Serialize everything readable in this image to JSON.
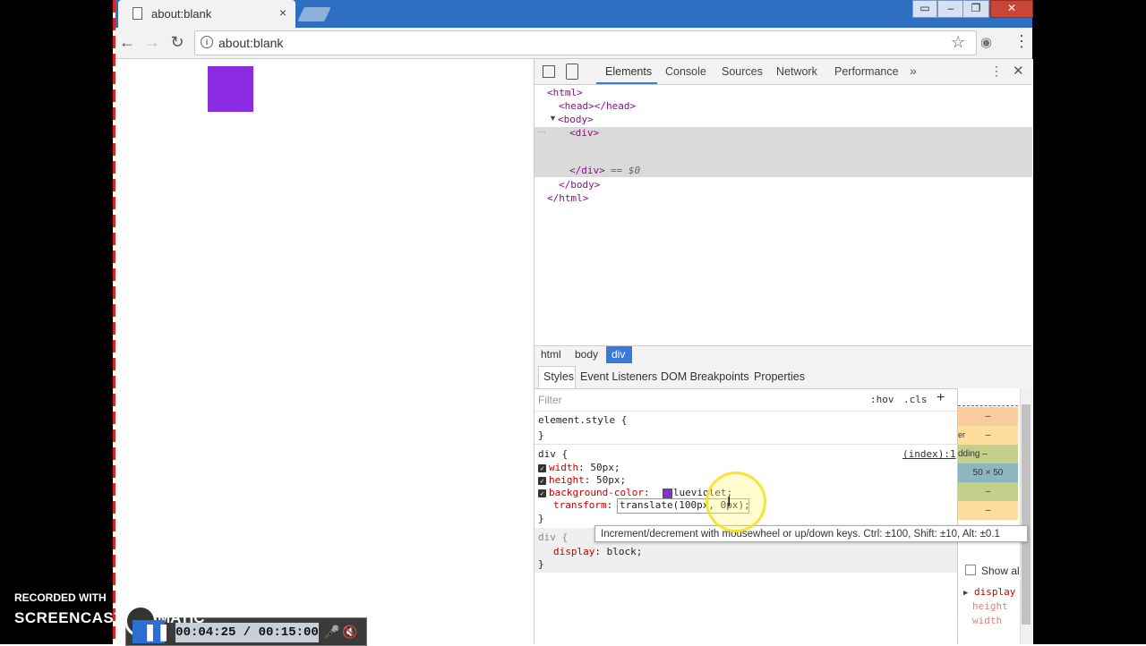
{
  "browser": {
    "tab_title": "about:blank",
    "tab_close": "×",
    "url": "about:blank",
    "win_buttons": {
      "restore": "▭",
      "minimize": "–",
      "maximize": "❐",
      "close": "✕"
    },
    "nav": {
      "back": "←",
      "forward": "→",
      "reload": "↻",
      "star": "☆",
      "camera": "◉",
      "menu": "⋮"
    }
  },
  "page": {
    "box_color": "#8a2be2"
  },
  "devtools": {
    "tabs": [
      "Elements",
      "Console",
      "Sources",
      "Network",
      "Performance"
    ],
    "more_tabs": "»",
    "kebab": "⋮",
    "close": "✕",
    "dom": {
      "html_open": "<html>",
      "head": "<head></head>",
      "body_open": "<body>",
      "body_toggle": "▼",
      "div_open": "<div>",
      "ellipsis": "···",
      "div_close": "</div>",
      "selected_marker": "== $0",
      "body_close": "</body>",
      "html_close": "</html>"
    },
    "breadcrumbs": [
      "html",
      "body",
      "div"
    ],
    "styles_tabs": [
      "Styles",
      "Event Listeners",
      "DOM Breakpoints",
      "Properties"
    ],
    "filter_placeholder": "Filter",
    "hov": ":hov",
    "cls": ".cls",
    "add": "+",
    "element_style": {
      "selector": "element.style {",
      "close": "}"
    },
    "rule": {
      "selector": "div {",
      "source": "(index):1",
      "checkbox": "✓",
      "props": [
        {
          "name": "width",
          "value": "50px;"
        },
        {
          "name": "height",
          "value": "50px;"
        },
        {
          "name": "background-color",
          "value": "blueviolet;"
        }
      ],
      "transform_name": "transform",
      "transform_value": "translate(100px, 0px);",
      "close": "}"
    },
    "ua_rule": {
      "selector": "div {",
      "prop": "display",
      "value": "block;",
      "close": "}"
    },
    "tooltip": "Increment/decrement with mousewheel or up/down keys. Ctrl: ±100, Shift: ±10, Alt: ±0.1",
    "box_model": [
      "–",
      "–",
      "dding –",
      "50 × 50",
      "–",
      "–"
    ],
    "box_model_border_label": "er",
    "show_all": "Show al",
    "computed": [
      "display",
      "height",
      "width"
    ],
    "computed_toggle": "▶"
  },
  "screencast": {
    "recorded_with": "RECORDED WITH",
    "logo_left": "SCREENCAST",
    "logo_right": "MATIC",
    "time": "00:04:25 / 00:15:00",
    "pause": "❚❚",
    "mic": "🎤",
    "speaker": "🔇"
  }
}
